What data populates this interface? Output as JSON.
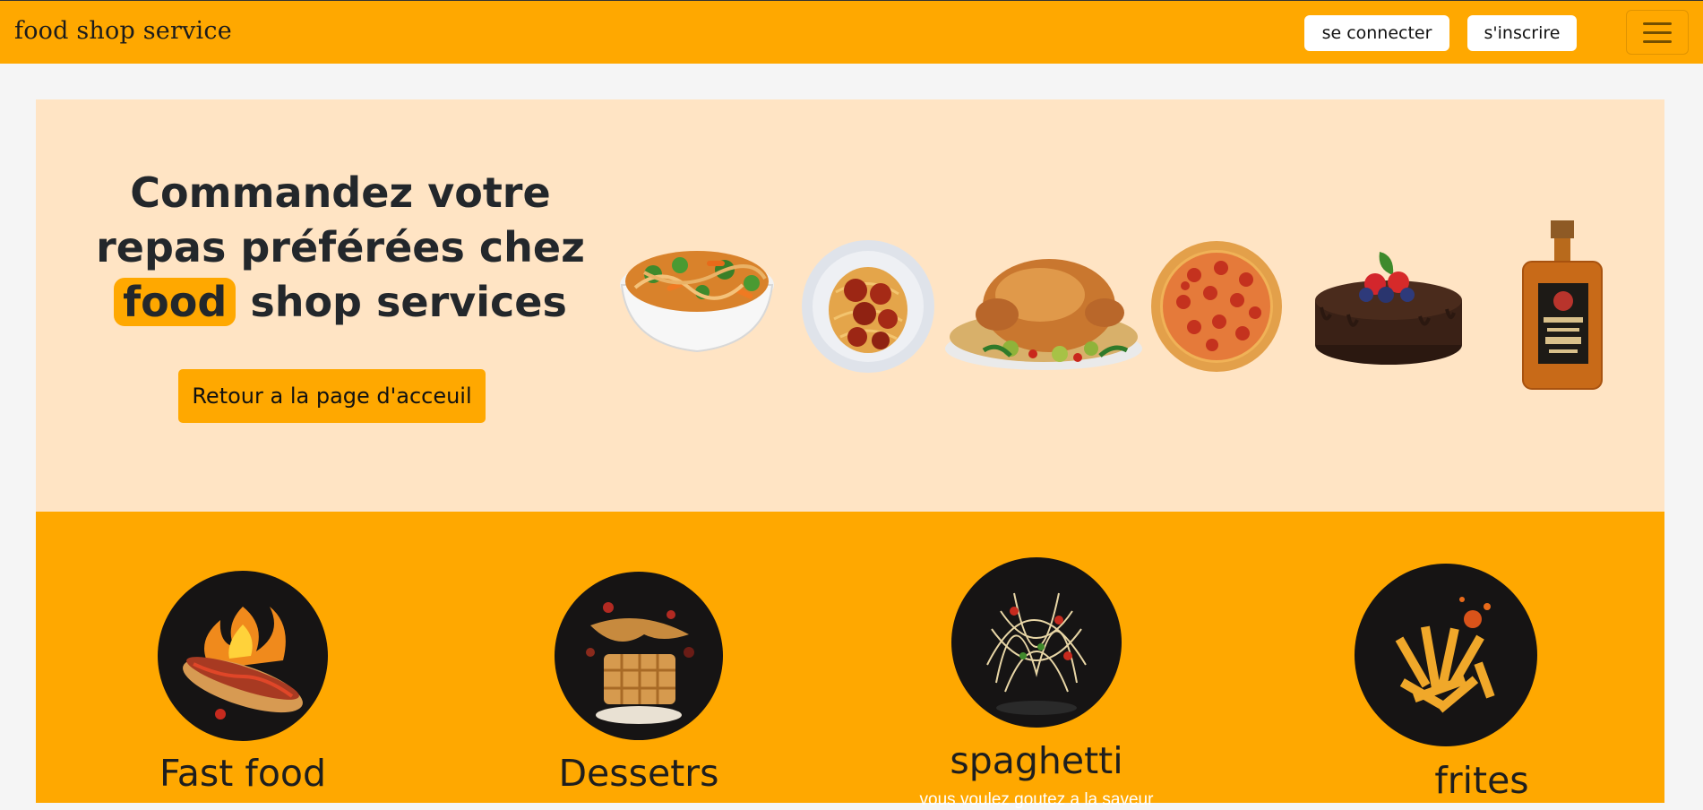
{
  "navbar": {
    "brand": "food shop service",
    "login_label": "se connecter",
    "signup_label": "s'inscrire",
    "menu_icon": "hamburger-menu-icon"
  },
  "hero": {
    "title_before": "Commandez votre repas préférées chez",
    "title_highlight": "food",
    "title_after": "shop services",
    "button_label": "Retour a la page d'acceuil",
    "images": [
      "noodle-bowl",
      "spaghetti-meatballs-plate",
      "roast-chicken",
      "pepperoni-pizza",
      "chocolate-cake",
      "rum-bottle"
    ]
  },
  "categories": [
    {
      "title": "Fast food",
      "image": "hotdog-flames"
    },
    {
      "title": "Dessetrs",
      "image": "waffle-dessert"
    },
    {
      "title": "spaghetti",
      "image": "spaghetti-splash",
      "description": "vous voulez goutez a la saveur"
    },
    {
      "title": "frites",
      "image": "french-fries"
    }
  ],
  "colors": {
    "accent": "#ffa800",
    "hero_bg": "#ffe4c4",
    "page_bg": "#f5f5f5",
    "text_dark": "#23272b"
  }
}
